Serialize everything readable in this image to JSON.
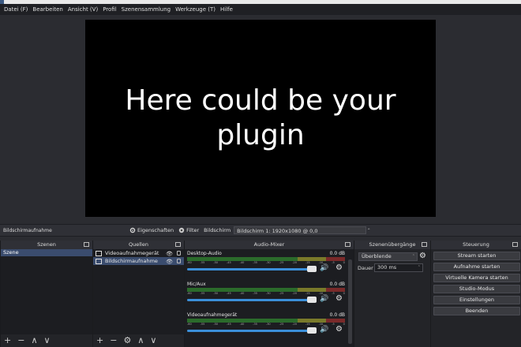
{
  "menu": [
    "Datei (F)",
    "Bearbeiten",
    "Ansicht (V)",
    "Profil",
    "Szenensammlung",
    "Werkzeuge (T)",
    "Hilfe"
  ],
  "preview": {
    "text": "Here could be your plugin"
  },
  "source_bar": {
    "selected_source": "Bildschirmaufnahme",
    "properties_label": "Eigenschaften",
    "filters_label": "Filter",
    "display_label": "Bildschirm",
    "display_value": "Bildschirm 1: 1920x1080 @ 0,0"
  },
  "scenes": {
    "title": "Szenen",
    "items": [
      "Szene"
    ]
  },
  "sources": {
    "title": "Quellen",
    "items": [
      {
        "label": "Videoaufnahmegerät",
        "icon": "camera-icon"
      },
      {
        "label": "Bildschirmaufnahme",
        "icon": "monitor-icon"
      }
    ]
  },
  "mixer": {
    "title": "Audio-Mixer",
    "ticks": [
      "-60",
      "-55",
      "-50",
      "-45",
      "-40",
      "-35",
      "-30",
      "-25",
      "-20",
      "-15",
      "-10",
      "-5",
      "0"
    ],
    "channels": [
      {
        "name": "Desktop-Audio",
        "db": "0.0 dB"
      },
      {
        "name": "Mic/Aux",
        "db": "0.0 dB"
      },
      {
        "name": "Videoaufnahmegerät",
        "db": "0.0 dB"
      }
    ]
  },
  "transitions": {
    "title": "Szenenübergänge",
    "selected": "Überblende",
    "duration_label": "Dauer",
    "duration_value": "300 ms"
  },
  "controls": {
    "title": "Steuerung",
    "buttons": [
      "Stream starten",
      "Aufnahme starten",
      "Virtuelle Kamera starten",
      "Studio-Modus",
      "Einstellungen",
      "Beenden"
    ]
  },
  "footer": {
    "add": "+",
    "remove": "−",
    "up": "∧",
    "down": "∨",
    "settings": "⚙"
  }
}
